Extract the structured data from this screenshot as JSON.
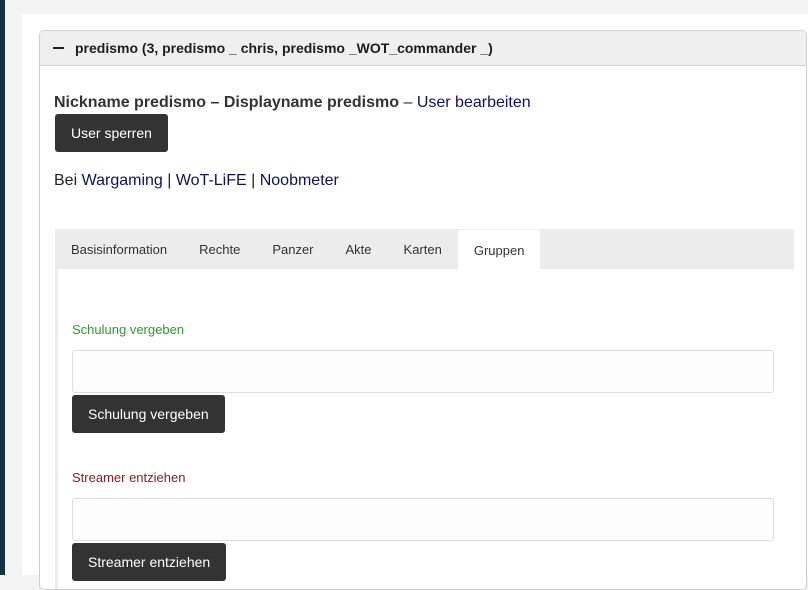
{
  "panel": {
    "title": "predismo (3, predismo _ chris, predismo _WOT_commander _)"
  },
  "user": {
    "nickname_line": "Nickname predismo – Displayname predismo",
    "separator": " – ",
    "edit_link": "User bearbeiten",
    "block_button": "User sperren"
  },
  "links": {
    "prefix": "Bei ",
    "items": [
      "Wargaming",
      "WoT-LiFE",
      "Noobmeter"
    ],
    "sep": " | "
  },
  "tabs": [
    {
      "label": "Basisinformation",
      "active": false
    },
    {
      "label": "Rechte",
      "active": false
    },
    {
      "label": "Panzer",
      "active": false
    },
    {
      "label": "Akte",
      "active": false
    },
    {
      "label": "Karten",
      "active": false
    },
    {
      "label": "Gruppen",
      "active": true
    }
  ],
  "groups": {
    "grant": {
      "label": "Schulung vergeben",
      "color": "#2a9d2a",
      "input_value": "",
      "button": "Schulung vergeben"
    },
    "revoke": {
      "label": "Streamer entziehen",
      "color": "#8b1a1a",
      "input_value": "",
      "button": "Streamer entziehen"
    }
  },
  "colors": {
    "left_bar": "#173342",
    "button_bg": "#333333",
    "link": "#0e0e6e"
  }
}
